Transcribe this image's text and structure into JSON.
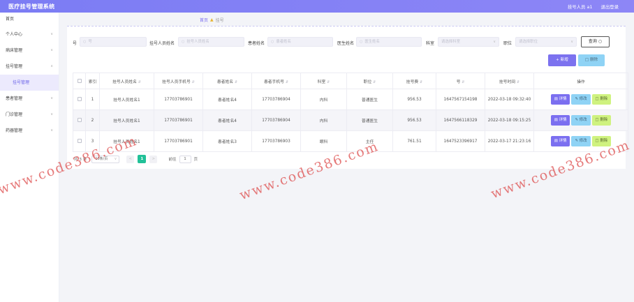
{
  "header": {
    "app_title": "医疗挂号管理系统",
    "user_label": "挂号人员 a1",
    "logout_label": "退出登录"
  },
  "sidebar": {
    "items": [
      {
        "label": "首页"
      },
      {
        "label": "个人中心"
      },
      {
        "label": "病床管理"
      },
      {
        "label": "挂号管理"
      },
      {
        "label": "患者管理"
      },
      {
        "label": "门诊管理"
      },
      {
        "label": "药器管理"
      }
    ],
    "active_sub": "挂号管理"
  },
  "breadcrumb": {
    "home": "首页",
    "current": "挂号"
  },
  "filters": {
    "f1_label": "号",
    "f1_placeholder": "号",
    "f2_label": "挂号人员姓名",
    "f2_placeholder": "挂号人员姓名",
    "f3_label": "患者姓名",
    "f3_placeholder": "患者姓名",
    "f4_label": "医生姓名",
    "f4_placeholder": "医生姓名",
    "f5_label": "科室",
    "f5_placeholder": "请选择科室",
    "f6_label": "职位",
    "f6_placeholder": "请选择职位",
    "query_label": "查询"
  },
  "actions": {
    "add_label": "新增",
    "delete_label": "删除"
  },
  "table": {
    "headers": [
      "索引",
      "挂号人员姓名",
      "挂号人员手机号",
      "患者姓名",
      "患者手机号",
      "科室",
      "职位",
      "挂号费",
      "号",
      "挂号时间",
      "操作"
    ],
    "rows": [
      {
        "index": "1",
        "reg_name": "挂号人员姓名1",
        "reg_phone": "17703786901",
        "patient_name": "患者姓名4",
        "patient_phone": "17703786904",
        "dept": "内科",
        "position": "普通医生",
        "fee": "956.53",
        "number": "1647567154198",
        "time": "2022-03-18 09:32:40"
      },
      {
        "index": "2",
        "reg_name": "挂号人员姓名1",
        "reg_phone": "17703786901",
        "patient_name": "患者姓名4",
        "patient_phone": "17703786904",
        "dept": "内科",
        "position": "普通医生",
        "fee": "956.53",
        "number": "1647566118329",
        "time": "2022-03-18 09:15:25"
      },
      {
        "index": "3",
        "reg_name": "挂号人员姓名1",
        "reg_phone": "17703786901",
        "patient_name": "患者姓名3",
        "patient_phone": "17703786903",
        "dept": "眼科",
        "position": "主任",
        "fee": "761.51",
        "number": "1647523396917",
        "time": "2022-03-17 21:23:16"
      }
    ],
    "row_actions": {
      "detail": "详情",
      "edit": "修改",
      "delete": "删除"
    }
  },
  "pagination": {
    "total_text": "共 3 条",
    "page_size": "10条/页",
    "prev": "<",
    "current_page": "1",
    "next": ">",
    "goto_label": "前往",
    "goto_value": "1",
    "page_suffix": "页"
  },
  "watermark": {
    "text": "www.code386.com"
  },
  "colors": {
    "topbar": "#7b7cf4",
    "accent": "#7b6ff0",
    "edit_button": "#8fd3f5",
    "delete_button": "#cff27f",
    "page_active": "#22c198"
  }
}
